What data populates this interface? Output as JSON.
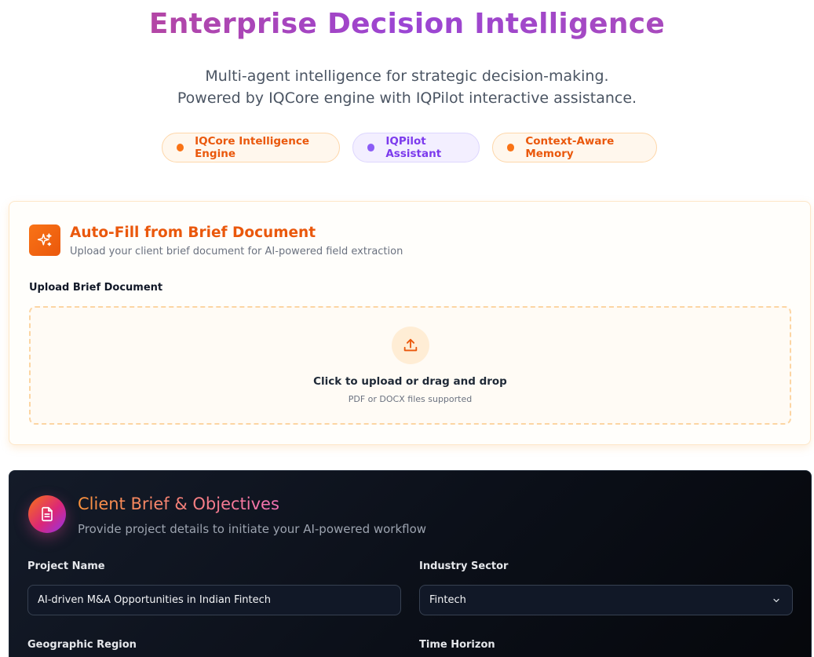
{
  "hero": {
    "title": "Enterprise Decision Intelligence",
    "subtitle_line1": "Multi-agent intelligence for strategic decision-making.",
    "subtitle_line2": "Powered by IQCore engine with IQPilot interactive assistance."
  },
  "badges": [
    {
      "label": "IQCore Intelligence Engine",
      "color": "#f97316"
    },
    {
      "label": "IQPilot Assistant",
      "color": "#8b5cf6"
    },
    {
      "label": "Context-Aware Memory",
      "color": "#f97316"
    }
  ],
  "autofill": {
    "icon": "sparkle-icon",
    "title": "Auto-Fill from Brief Document",
    "subtitle": "Upload your client brief document for AI-powered field extraction",
    "upload_label": "Upload Brief Document",
    "dropzone_icon": "upload-icon",
    "dropzone_text": "Click to upload or drag and drop",
    "dropzone_hint": "PDF or DOCX files supported"
  },
  "brief": {
    "icon": "document-icon",
    "title": "Client Brief & Objectives",
    "subtitle": "Provide project details to initiate your AI-powered workflow",
    "fields": {
      "project_name": {
        "label": "Project Name",
        "value": "AI-driven M&A Opportunities in Indian Fintech"
      },
      "industry_sector": {
        "label": "Industry Sector",
        "value": "Fintech"
      },
      "geographic_region": {
        "label": "Geographic Region"
      },
      "time_horizon": {
        "label": "Time Horizon"
      }
    }
  },
  "colors": {
    "accent_orange": "#ea580c",
    "accent_purple": "#7c3aed",
    "dark_panel": "#0b0f18"
  }
}
